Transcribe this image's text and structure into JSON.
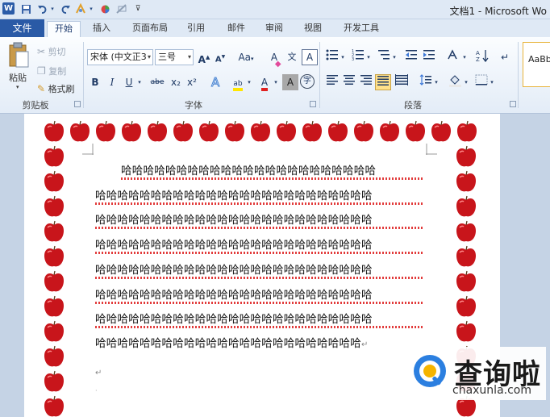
{
  "window": {
    "title": "文档1 - Microsoft Wo"
  },
  "quick_access": {
    "app_icon": "W",
    "save": "save-icon",
    "undo": "undo-icon",
    "redo": "redo-icon"
  },
  "tabs": {
    "file": "文件",
    "items": [
      "开始",
      "插入",
      "页面布局",
      "引用",
      "邮件",
      "审阅",
      "视图",
      "开发工具"
    ]
  },
  "clipboard": {
    "paste": "粘贴",
    "cut": "剪切",
    "copy": "复制",
    "format_painter": "格式刷",
    "group_label": "剪贴板"
  },
  "font": {
    "font_name": "宋体 (中文正3",
    "font_size": "三号",
    "grow": "A",
    "shrink": "A",
    "change_case": "Aa",
    "clear_format": "A",
    "pinyin": "文",
    "border": "A",
    "bold": "B",
    "italic": "I",
    "underline": "U",
    "strikethrough": "abe",
    "subscript": "x₂",
    "superscript": "x²",
    "highlight": "ab",
    "font_color": "A",
    "shading": "A",
    "enclose": "字",
    "group_label": "字体"
  },
  "paragraph": {
    "group_label": "段落"
  },
  "styles": {
    "preview": "AaBbC"
  },
  "document": {
    "lines": [
      "哈哈哈哈哈哈哈哈哈哈哈哈哈哈哈哈哈哈哈哈哈哈哈",
      "哈哈哈哈哈哈哈哈哈哈哈哈哈哈哈哈哈哈哈哈哈哈哈哈哈",
      "哈哈哈哈哈哈哈哈哈哈哈哈哈哈哈哈哈哈哈哈哈哈哈哈哈",
      "哈哈哈哈哈哈哈哈哈哈哈哈哈哈哈哈哈哈哈哈哈哈哈哈哈",
      "哈哈哈哈哈哈哈哈哈哈哈哈哈哈哈哈哈哈哈哈哈哈哈哈哈",
      "哈哈哈哈哈哈哈哈哈哈哈哈哈哈哈哈哈哈哈哈哈哈哈哈哈",
      "哈哈哈哈哈哈哈哈哈哈哈哈哈哈哈哈哈哈哈哈哈哈哈哈哈",
      "哈哈哈哈哈哈哈哈哈哈哈哈哈哈哈哈哈哈哈哈哈哈哈哈"
    ],
    "para_mark": "↵"
  },
  "watermark": {
    "name_cn": "查询啦",
    "url": "chaxunla.com"
  },
  "colors": {
    "file_tab": "#2a5aa6",
    "apple_red": "#c8151b",
    "squiggle": "#e23b3b"
  }
}
